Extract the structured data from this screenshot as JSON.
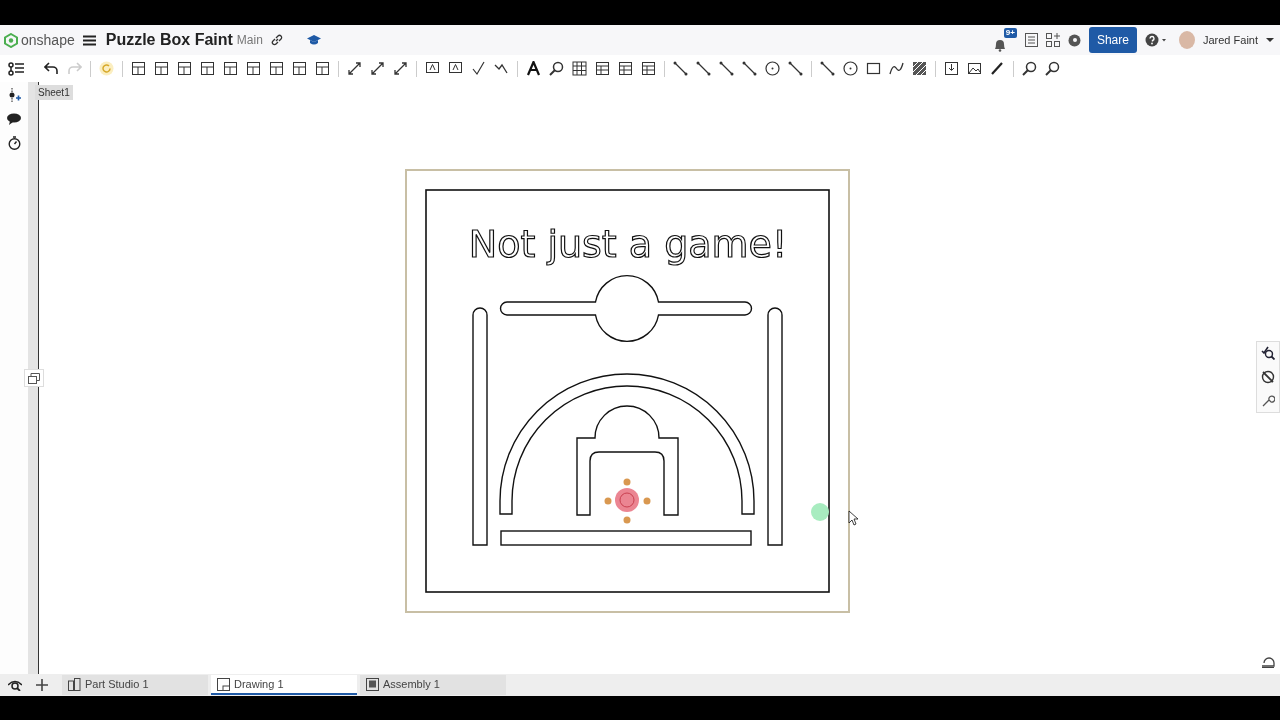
{
  "app": {
    "name": "onshape"
  },
  "document": {
    "title": "Puzzle Box Faint",
    "branch": "Main"
  },
  "header": {
    "notification_count": "9+",
    "share": "Share",
    "user": "Jared Faint"
  },
  "sheet_tab": {
    "label": "Sheet1"
  },
  "drawing": {
    "text": "Not just a game!"
  },
  "tabs": [
    {
      "label": "Part Studio 1",
      "selected": false,
      "kind": "part"
    },
    {
      "label": "Drawing 1",
      "selected": true,
      "kind": "drawing"
    },
    {
      "label": "Assembly 1",
      "selected": false,
      "kind": "assembly"
    }
  ]
}
